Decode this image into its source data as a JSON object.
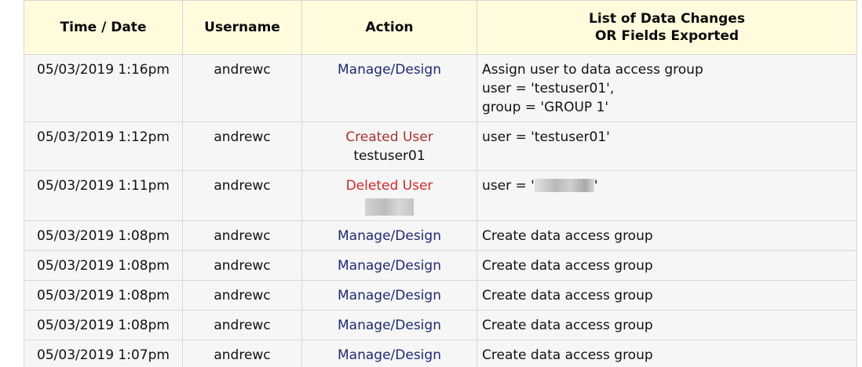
{
  "table": {
    "headers": {
      "time": "Time / Date",
      "username": "Username",
      "action": "Action",
      "changes_line1": "List of Data Changes",
      "changes_line2": "OR Fields Exported"
    },
    "rows": [
      {
        "time": "05/03/2019 1:16pm",
        "username": "andrewc",
        "action": "Manage/Design",
        "action_type": "manage",
        "changes": [
          "Assign user to data access group",
          "user = 'testuser01',",
          "group = 'GROUP 1'"
        ]
      },
      {
        "time": "05/03/2019 1:12pm",
        "username": "andrewc",
        "action": "Created User",
        "action_type": "created",
        "action_target": "testuser01",
        "changes": [
          "user = 'testuser01'"
        ]
      },
      {
        "time": "05/03/2019 1:11pm",
        "username": "andrewc",
        "action": "Deleted User",
        "action_type": "deleted",
        "changes_prefix": "user = '",
        "changes_suffix": "'"
      },
      {
        "time": "05/03/2019 1:08pm",
        "username": "andrewc",
        "action": "Manage/Design",
        "action_type": "manage",
        "changes": [
          "Create data access group"
        ]
      },
      {
        "time": "05/03/2019 1:08pm",
        "username": "andrewc",
        "action": "Manage/Design",
        "action_type": "manage",
        "changes": [
          "Create data access group"
        ]
      },
      {
        "time": "05/03/2019 1:08pm",
        "username": "andrewc",
        "action": "Manage/Design",
        "action_type": "manage",
        "changes": [
          "Create data access group"
        ]
      },
      {
        "time": "05/03/2019 1:08pm",
        "username": "andrewc",
        "action": "Manage/Design",
        "action_type": "manage",
        "changes": [
          "Create data access group"
        ]
      },
      {
        "time": "05/03/2019 1:07pm",
        "username": "andrewc",
        "action": "Manage/Design",
        "action_type": "manage",
        "changes": [
          "Create data access group"
        ]
      }
    ]
  },
  "colors": {
    "header_bg": "#fffbdc",
    "row_bg": "#f6f6f6",
    "border": "#d9d9d9",
    "action_manage": "#1f2a73",
    "action_created": "#a8322b",
    "action_deleted": "#cf2a2a"
  }
}
